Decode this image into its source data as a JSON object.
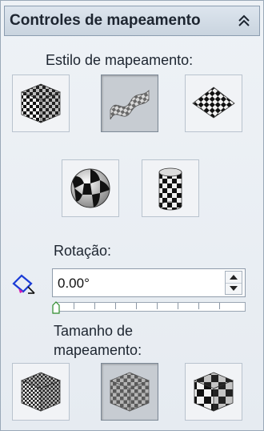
{
  "header": {
    "title": "Controles de mapeamento",
    "collapse_icon": "double-chevron-up-icon"
  },
  "style_section": {
    "label": "Estilo de mapeamento:",
    "buttons": [
      {
        "name": "cube",
        "icon": "checker-cube-icon",
        "active": false
      },
      {
        "name": "surface",
        "icon": "checker-surface-icon",
        "active": true
      },
      {
        "name": "plane",
        "icon": "checker-plane-icon",
        "active": false
      },
      {
        "name": "sphere",
        "icon": "checker-sphere-icon",
        "active": false
      },
      {
        "name": "cylinder",
        "icon": "checker-cylinder-icon",
        "active": false
      }
    ]
  },
  "rotation": {
    "label": "Rotação:",
    "icon": "rotate-diamond-icon",
    "value": "0.00°",
    "slider_fraction": 0.0
  },
  "size_section": {
    "label_line1": "Tamanho de",
    "label_line2": "mapeamento:",
    "buttons": [
      {
        "name": "small",
        "icon": "checker-cube-small-icon",
        "active": false
      },
      {
        "name": "medium",
        "icon": "checker-cube-medium-icon",
        "active": true
      },
      {
        "name": "large",
        "icon": "checker-cube-large-icon",
        "active": false
      }
    ]
  },
  "colors": {
    "accent": "#1a3bd6",
    "panel_bg": "#e6ebf1"
  }
}
